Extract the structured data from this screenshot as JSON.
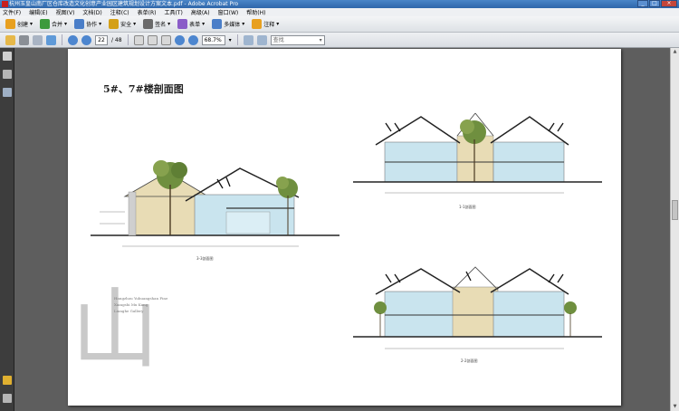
{
  "window": {
    "title": "杭州玉皇山南厂区仓库改造文化创意产业园区建筑规划设计方案文本.pdf - Adobe Acrobat Pro",
    "controls": [
      "_",
      "□",
      "×"
    ]
  },
  "menu": [
    "文件(F)",
    "编辑(E)",
    "视图(V)",
    "文档(D)",
    "注释(C)",
    "表单(R)",
    "工具(T)",
    "高级(A)",
    "窗口(W)",
    "帮助(H)"
  ],
  "toolbar": {
    "items": [
      {
        "label": "创建",
        "icon": "create-icon",
        "color": "#e8a020"
      },
      {
        "label": "合并",
        "icon": "combine-icon",
        "color": "#3c9a3c"
      },
      {
        "label": "协作",
        "icon": "collaborate-icon",
        "color": "#4a7ec8"
      },
      {
        "label": "安全",
        "icon": "lock-icon",
        "color": "#d4a017"
      },
      {
        "label": "签名",
        "icon": "pen-icon",
        "color": "#6a6a6a"
      },
      {
        "label": "表单",
        "icon": "form-icon",
        "color": "#8a5cc8"
      },
      {
        "label": "多媒体",
        "icon": "multimedia-icon",
        "color": "#4a7ec8"
      },
      {
        "label": "注释",
        "icon": "comment-icon",
        "color": "#e8a020"
      }
    ]
  },
  "nav": {
    "current_page": "22",
    "total_pages": "/ 48",
    "zoom": "68.7%",
    "find_placeholder": "查找"
  },
  "document": {
    "heading": "5#、7#楼剖面图",
    "watermark": "山",
    "credits": [
      "Hangzhou Yuhuangshan Fine",
      "Xiangshi Mu Kang",
      "Lianghe Gallery"
    ],
    "sections": [
      {
        "caption": "3-3剖面图"
      },
      {
        "caption": "1-1剖面图"
      },
      {
        "caption": "2-2剖面图"
      }
    ]
  },
  "colors": {
    "titlebar": "#2e66aa",
    "sky_blue_wall": "#c9e4ee",
    "beige_wall": "#e8dcb5",
    "roof_line": "#222222"
  }
}
